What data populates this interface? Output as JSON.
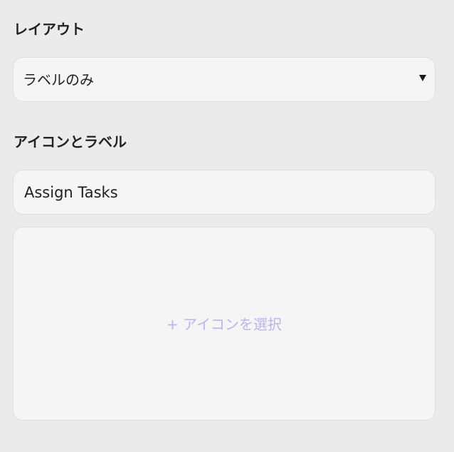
{
  "layout_section": {
    "label": "レイアウト",
    "selected_option": "ラベルのみ",
    "arrow_icon": "triangle-down-icon"
  },
  "icon_label_section": {
    "label": "アイコンとラベル",
    "label_value": "Assign Tasks",
    "picker": {
      "icon": "plus-icon",
      "plus_glyph": "+",
      "cta_text": "アイコンを選択"
    }
  },
  "colors": {
    "background": "#ebebeb",
    "field_background": "#f5f5f5",
    "field_border": "#dedede",
    "placeholder_accent": "#b9b4ef",
    "text": "#1f1f1f"
  }
}
